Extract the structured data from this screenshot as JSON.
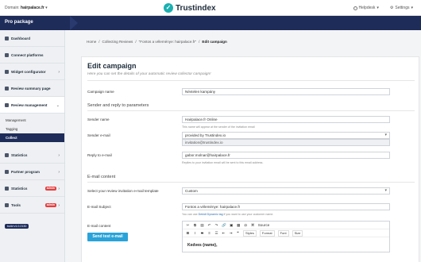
{
  "topbar": {
    "domain_label": "Domain:",
    "domain_value": "hairpalace.fr",
    "brand": "Trustindex",
    "helpdesk": "Helpdesk",
    "settings": "Settings"
  },
  "proband": {
    "label": "Pro package"
  },
  "sidebar": {
    "items": [
      {
        "label": "Dashboard",
        "icon": "dashboard-icon"
      },
      {
        "label": "Connect platforms",
        "icon": "link-icon"
      },
      {
        "label": "Widget configurator",
        "icon": "widget-icon"
      },
      {
        "label": "Review summary page",
        "icon": "page-icon"
      },
      {
        "label": "Review management",
        "icon": "chat-icon"
      }
    ],
    "subitems": [
      "Management",
      "Tagging",
      "Collect"
    ],
    "lower": [
      {
        "label": "Statistics",
        "icon": "chart-icon"
      },
      {
        "label": "Partner program",
        "icon": "partner-icon"
      },
      {
        "label": "Statistics",
        "icon": "chart-icon",
        "badge": "admin"
      },
      {
        "label": "Tools",
        "icon": "tools-icon",
        "badge": "admin"
      }
    ],
    "build": "build v1.0.2130"
  },
  "breadcrumb": {
    "home": "Home",
    "collect": "Collecting Reviews",
    "campaign": "\"Fontos a véleménye: hairpalace.fr\"",
    "current": "Edit campaign"
  },
  "card": {
    "title": "Edit campaign",
    "subtitle": "Here you can set the details of your automatic review collector campaign!",
    "campaign_name_label": "Campaign name",
    "campaign_name_value": "Névtelen kampány",
    "section_sender": "Sender and reply to parameters",
    "sender_name_label": "Sender name",
    "sender_name_value": "Hairpalace.fr Online",
    "sender_name_help": "This name will appear at the sender of the invitation email",
    "sender_email_label": "Sender e-mail",
    "sender_email_select": "provided by Trustindex.io",
    "sender_email_value": "invitation@trustindex.io",
    "reply_label": "Reply to e-mail",
    "reply_value": "gabor.molnar@hairpalace.fr",
    "reply_help": "Replies to your invitation email will be sent to this email address.",
    "section_email": "E-mail content",
    "template_label": "Select your review invitation e-mail template",
    "template_value": "Custom",
    "subject_label": "E-mail Subject",
    "subject_value": "Fontos a véleménye: hairpalace.fr",
    "subject_help_pre": "You can use",
    "subject_help_link": "Dekidi Dynamic tag",
    "subject_help_post": "if you want to use your customer name.",
    "content_label": "E-mail content",
    "test_button": "Send test e-mail",
    "toolbar": {
      "source": "Source",
      "styles": "Styles",
      "format": "Format",
      "font": "Font",
      "size": "Size"
    },
    "editor_text": "Kedves {name},"
  }
}
